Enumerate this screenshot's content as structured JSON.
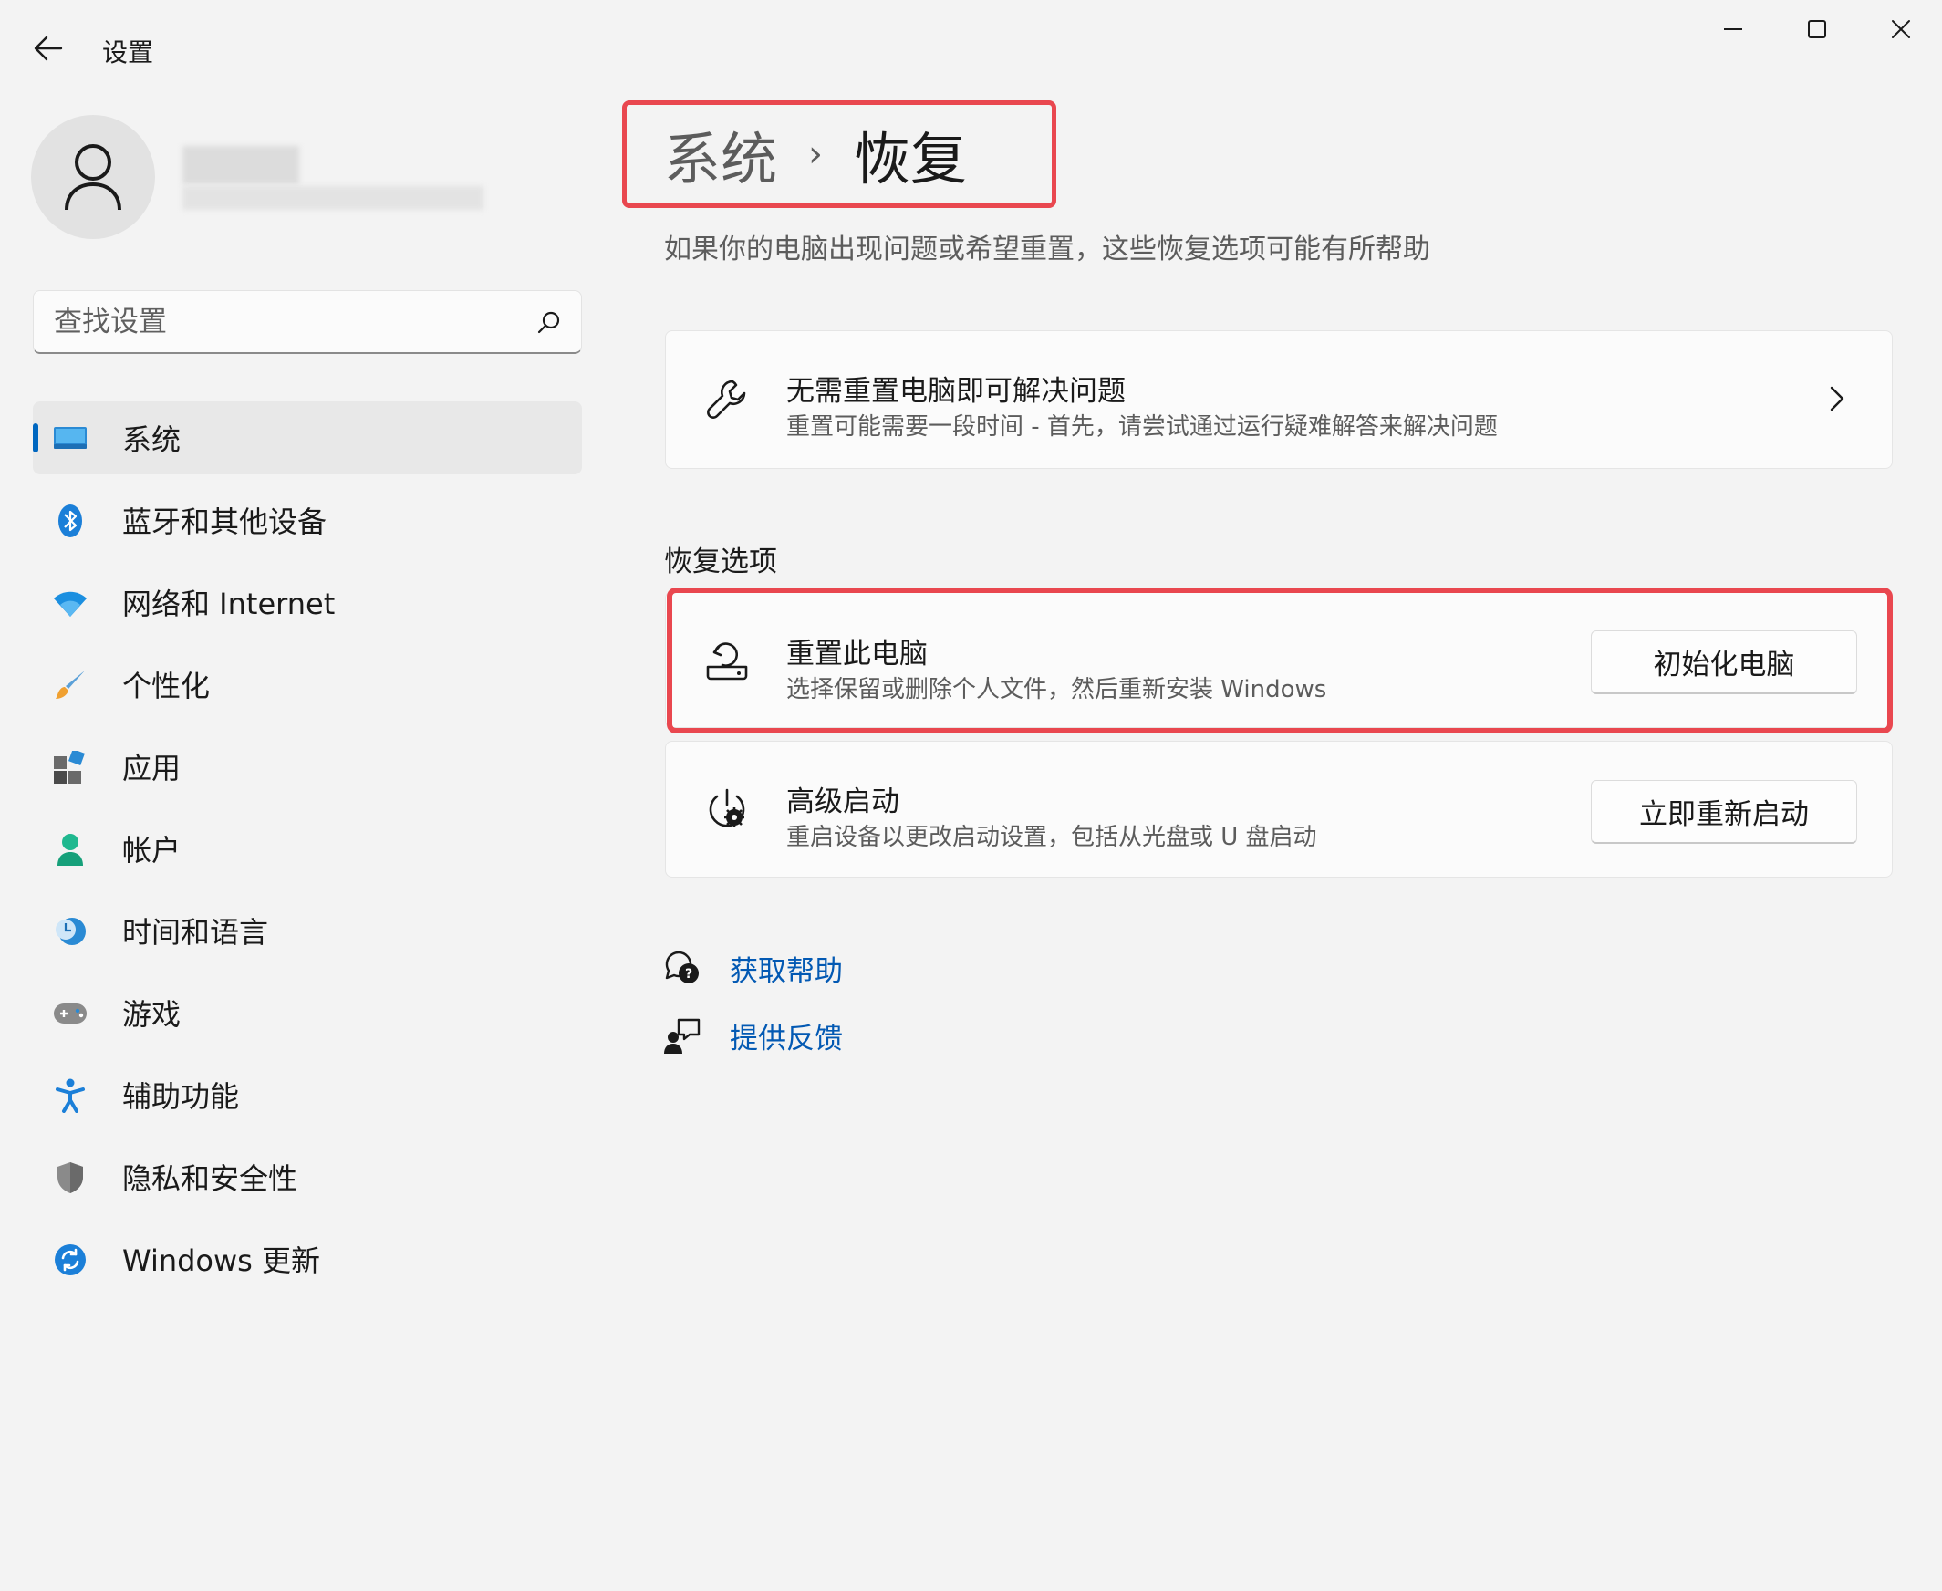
{
  "window": {
    "title": "设置"
  },
  "search": {
    "placeholder": "查找设置"
  },
  "sidebar": {
    "items": [
      {
        "label": "系统",
        "icon": "system-icon",
        "active": true
      },
      {
        "label": "蓝牙和其他设备",
        "icon": "bluetooth-icon"
      },
      {
        "label": "网络和 Internet",
        "icon": "wifi-icon"
      },
      {
        "label": "个性化",
        "icon": "brush-icon"
      },
      {
        "label": "应用",
        "icon": "apps-icon"
      },
      {
        "label": "帐户",
        "icon": "account-icon"
      },
      {
        "label": "时间和语言",
        "icon": "clock-globe-icon"
      },
      {
        "label": "游戏",
        "icon": "gamepad-icon"
      },
      {
        "label": "辅助功能",
        "icon": "accessibility-icon"
      },
      {
        "label": "隐私和安全性",
        "icon": "shield-icon"
      },
      {
        "label": "Windows 更新",
        "icon": "update-icon"
      }
    ]
  },
  "main": {
    "breadcrumb": {
      "parent": "系统",
      "separator": "›",
      "current": "恢复"
    },
    "description": "如果你的电脑出现问题或希望重置，这些恢复选项可能有所帮助",
    "troubleshoot": {
      "title": "无需重置电脑即可解决问题",
      "subtitle": "重置可能需要一段时间 - 首先，请尝试通过运行疑难解答来解决问题"
    },
    "section_title": "恢复选项",
    "reset": {
      "title": "重置此电脑",
      "subtitle": "选择保留或删除个人文件，然后重新安装 Windows",
      "button": "初始化电脑"
    },
    "advanced": {
      "title": "高级启动",
      "subtitle": "重启设备以更改启动设置，包括从光盘或 U 盘启动",
      "button": "立即重新启动"
    },
    "links": {
      "help": "获取帮助",
      "feedback": "提供反馈"
    }
  },
  "colors": {
    "accent": "#0067c0",
    "link": "#0359b3",
    "highlight": "#e9474f"
  }
}
